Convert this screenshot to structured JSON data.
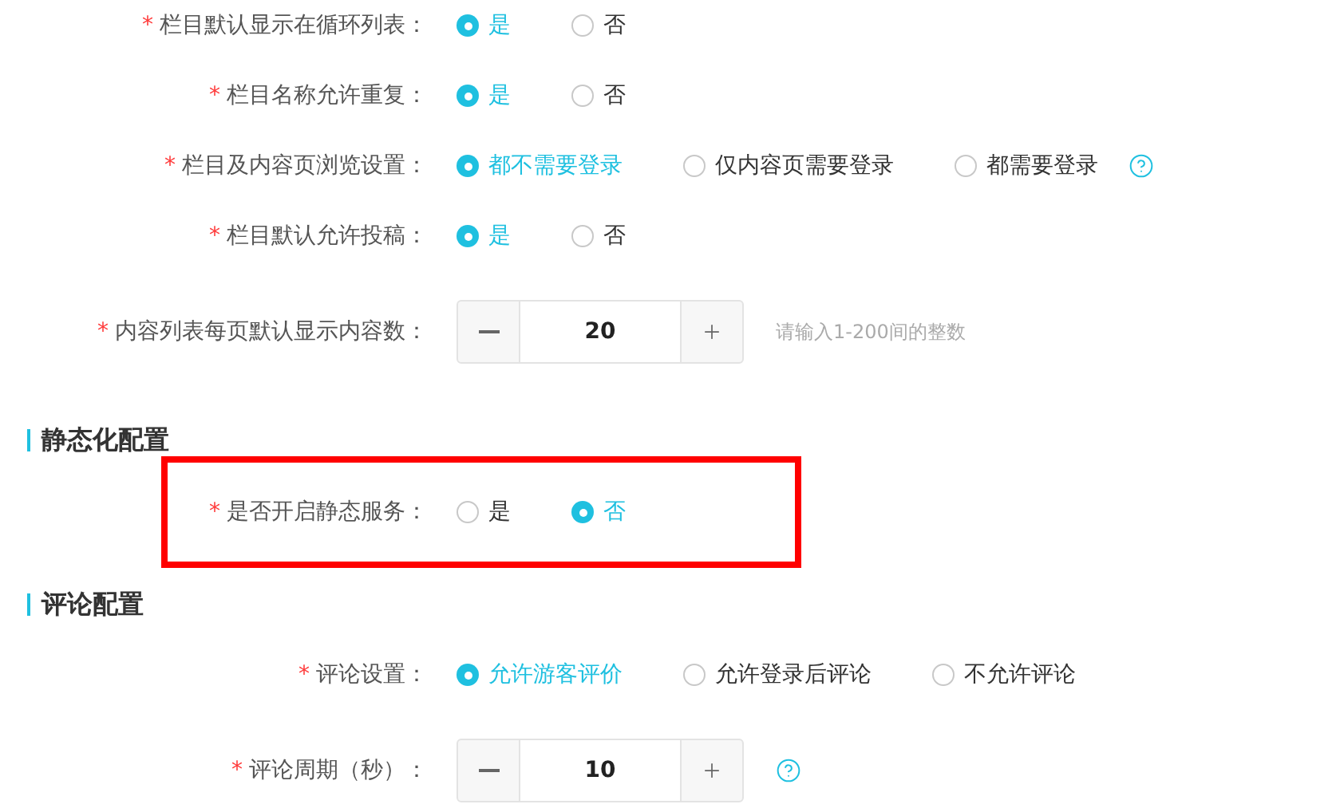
{
  "sections": [
    {
      "rows": [
        {
          "kind": "radio",
          "marker": "*",
          "label": "栏目默认显示在循环列表：",
          "options": [
            {
              "label": "是",
              "selected": true
            },
            {
              "label": "否",
              "selected": false
            }
          ]
        },
        {
          "kind": "radio",
          "marker": "*",
          "label": "栏目名称允许重复：",
          "options": [
            {
              "label": "是",
              "selected": true
            },
            {
              "label": "否",
              "selected": false
            }
          ]
        },
        {
          "kind": "radio",
          "marker": "*",
          "label": "栏目及内容页浏览设置：",
          "help": true,
          "options": [
            {
              "label": "都不需要登录",
              "selected": true
            },
            {
              "label": "仅内容页需要登录",
              "selected": false
            },
            {
              "label": "都需要登录",
              "selected": false
            }
          ]
        },
        {
          "kind": "radio",
          "marker": "*",
          "label": "栏目默认允许投稿：",
          "options": [
            {
              "label": "是",
              "selected": true
            },
            {
              "label": "否",
              "selected": false
            }
          ]
        },
        {
          "kind": "number",
          "marker": "*",
          "label": "内容列表每页默认显示内容数：",
          "value": "20",
          "hint": "请输入1-200间的整数"
        }
      ]
    },
    {
      "heading": "静态化配置",
      "rows": [
        {
          "kind": "radio",
          "marker": "*",
          "label": "是否开启静态服务：",
          "highlighted": true,
          "options": [
            {
              "label": "是",
              "selected": false
            },
            {
              "label": "否",
              "selected": true
            }
          ]
        }
      ]
    },
    {
      "heading": "评论配置",
      "rows": [
        {
          "kind": "radio",
          "marker": "*",
          "label": "评论设置：",
          "options": [
            {
              "label": "允许游客评价",
              "selected": true
            },
            {
              "label": "允许登录后评论",
              "selected": false
            },
            {
              "label": "不允许评论",
              "selected": false
            }
          ]
        },
        {
          "kind": "number",
          "marker": "*",
          "label": "评论周期（秒）：",
          "value": "10",
          "help": true
        }
      ]
    }
  ]
}
